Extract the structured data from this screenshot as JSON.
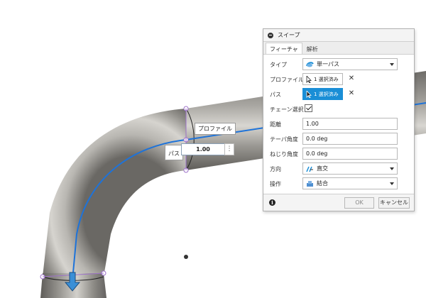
{
  "canvas": {
    "path_label": "パス",
    "profile_label": "プロファイル",
    "distance_value": "1.00",
    "more_glyph": "⋮",
    "colors": {
      "pipe": "#8c8a85",
      "path": "#1e73d9",
      "handle": "#9d72c9"
    }
  },
  "dialog": {
    "title": "スイープ",
    "tabs": [
      {
        "label": "フィーチャ",
        "active": true
      },
      {
        "label": "解析",
        "active": false
      }
    ],
    "type": {
      "label": "タイプ",
      "value": "単一パス",
      "icon": "sweep-single-path-icon"
    },
    "profile": {
      "label": "プロファイル",
      "value": "1 選択済み",
      "clear": "✕",
      "icon": "cursor-icon"
    },
    "path": {
      "label": "パス",
      "value": "1 選択済み",
      "clear": "✕",
      "icon": "cursor-icon"
    },
    "chain": {
      "label": "チェーン選択",
      "checked": true
    },
    "distance": {
      "label": "距離",
      "value": "1.00"
    },
    "taper": {
      "label": "テーパ角度",
      "value": "0.0 deg"
    },
    "twist": {
      "label": "ねじり角度",
      "value": "0.0 deg"
    },
    "orientation": {
      "label": "方向",
      "value": "直交",
      "icon": "perpendicular-icon"
    },
    "operation": {
      "label": "操作",
      "value": "結合",
      "icon": "join-icon"
    },
    "ok_label": "OK",
    "cancel_label": "キャンセル",
    "info_glyph": "i",
    "accent": "#1a8ed6"
  }
}
